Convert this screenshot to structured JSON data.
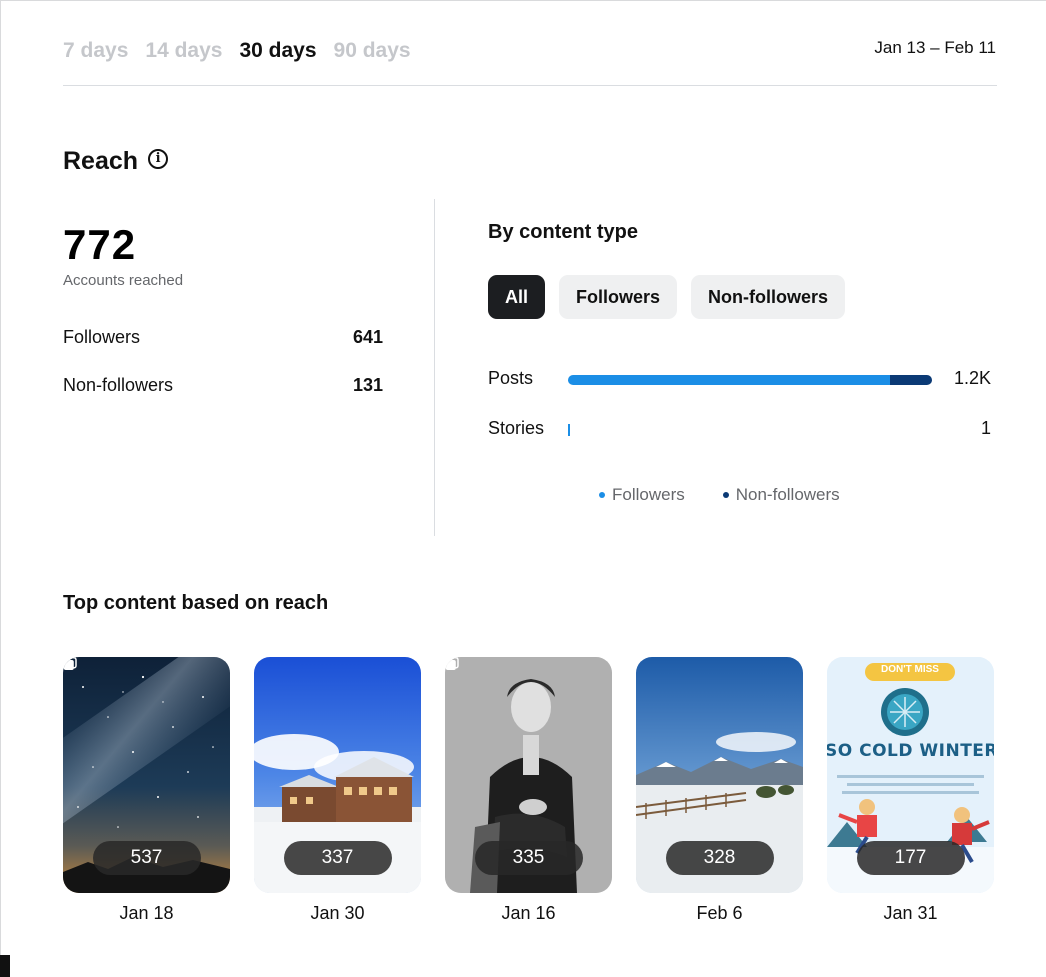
{
  "range_tabs": [
    {
      "label": "7 days",
      "active": false
    },
    {
      "label": "14 days",
      "active": false
    },
    {
      "label": "30 days",
      "active": true
    },
    {
      "label": "90 days",
      "active": false
    }
  ],
  "date_range": "Jan 13 – Feb 11",
  "reach": {
    "title": "Reach",
    "info_icon": "info-icon",
    "total": "772",
    "total_label": "Accounts reached",
    "followers_label": "Followers",
    "followers_value": "641",
    "non_followers_label": "Non-followers",
    "non_followers_value": "131"
  },
  "by_content_type": {
    "title": "By content type",
    "chips": [
      {
        "label": "All",
        "active": true
      },
      {
        "label": "Followers",
        "active": false
      },
      {
        "label": "Non-followers",
        "active": false
      }
    ],
    "rows": [
      {
        "label": "Posts",
        "value": "1.2K",
        "followers_share": 0.885,
        "non_followers_share": 0.115
      },
      {
        "label": "Stories",
        "value": "1",
        "followers_share": 1.0,
        "non_followers_share": 0.0
      }
    ],
    "legend": [
      {
        "label": "Followers",
        "color": "#1b8ee6"
      },
      {
        "label": "Non-followers",
        "color": "#0b3a75"
      }
    ]
  },
  "top_content": {
    "title": "Top content based on reach",
    "items": [
      {
        "count": "537",
        "date": "Jan 18",
        "carousel": true
      },
      {
        "count": "337",
        "date": "Jan 30",
        "carousel": false
      },
      {
        "count": "335",
        "date": "Jan 16",
        "carousel": true
      },
      {
        "count": "328",
        "date": "Feb 6",
        "carousel": false
      },
      {
        "count": "177",
        "date": "Jan 31",
        "carousel": false
      }
    ],
    "poster": {
      "badge": "DON'T MISS",
      "headline": "SO COLD WINTERFES"
    }
  }
}
